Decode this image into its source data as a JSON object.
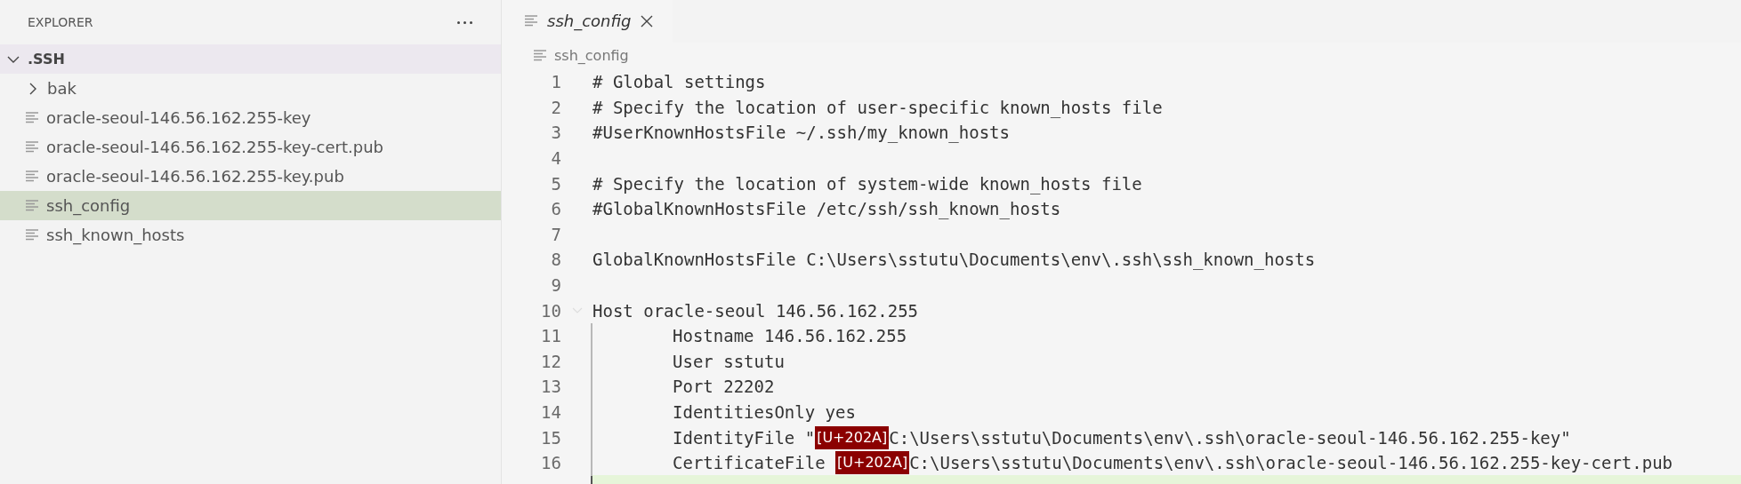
{
  "sidebar": {
    "title": "EXPLORER",
    "folder": {
      "label": ".SSH",
      "expanded": true,
      "children": [
        {
          "kind": "folder",
          "label": "bak",
          "expanded": false,
          "selected": false
        },
        {
          "kind": "file",
          "label": "oracle-seoul-146.56.162.255-key",
          "selected": false
        },
        {
          "kind": "file",
          "label": "oracle-seoul-146.56.162.255-key-cert.pub",
          "selected": false
        },
        {
          "kind": "file",
          "label": "oracle-seoul-146.56.162.255-key.pub",
          "selected": false
        },
        {
          "kind": "file",
          "label": "ssh_config",
          "selected": true
        },
        {
          "kind": "file",
          "label": "ssh_known_hosts",
          "selected": false
        }
      ]
    }
  },
  "tabs": [
    {
      "label": "ssh_config",
      "selected": true,
      "preview": true
    }
  ],
  "breadcrumb": {
    "label": "ssh_config"
  },
  "editor": {
    "lines": [
      {
        "number": "1",
        "indented": false,
        "parts": [
          {
            "kind": "text",
            "text": "# Global settings"
          }
        ]
      },
      {
        "number": "2",
        "indented": false,
        "parts": [
          {
            "kind": "text",
            "text": "# Specify the location of user-specific known_hosts file"
          }
        ]
      },
      {
        "number": "3",
        "indented": false,
        "parts": [
          {
            "kind": "text",
            "text": "#UserKnownHostsFile ~/.ssh/my_known_hosts"
          }
        ]
      },
      {
        "number": "4",
        "indented": false
      },
      {
        "number": "5",
        "indented": false,
        "parts": [
          {
            "kind": "text",
            "text": "# Specify the location of system-wide known_hosts file"
          }
        ]
      },
      {
        "number": "6",
        "indented": false,
        "parts": [
          {
            "kind": "text",
            "text": "#GlobalKnownHostsFile /etc/ssh/ssh_known_hosts"
          }
        ]
      },
      {
        "number": "7",
        "indented": false
      },
      {
        "number": "8",
        "indented": false,
        "parts": [
          {
            "kind": "text",
            "text": "GlobalKnownHostsFile C:\\Users\\sstutu\\Documents\\env\\.ssh\\ssh_known_hosts"
          }
        ]
      },
      {
        "number": "9",
        "indented": false
      },
      {
        "number": "10",
        "indented": false,
        "foldable": true,
        "parts": [
          {
            "kind": "text",
            "text": "Host oracle-seoul 146.56.162.255"
          }
        ]
      },
      {
        "number": "11",
        "indented": true,
        "parts": [
          {
            "kind": "text",
            "text": "Hostname 146.56.162.255"
          }
        ]
      },
      {
        "number": "12",
        "indented": true,
        "parts": [
          {
            "kind": "text",
            "text": "User sstutu"
          }
        ]
      },
      {
        "number": "13",
        "indented": true,
        "parts": [
          {
            "kind": "text",
            "text": "Port 22202"
          }
        ]
      },
      {
        "number": "14",
        "indented": true,
        "parts": [
          {
            "kind": "text",
            "text": "IdentitiesOnly yes"
          }
        ]
      },
      {
        "number": "15",
        "indented": true,
        "parts": [
          {
            "kind": "text",
            "text": "IdentityFile \""
          },
          {
            "kind": "control",
            "text": "[U+202A]"
          },
          {
            "kind": "text",
            "text": "C:\\Users\\sstutu\\Documents\\env\\.ssh\\oracle-seoul-146.56.162.255-key\""
          }
        ]
      },
      {
        "number": "16",
        "indented": true,
        "parts": [
          {
            "kind": "text",
            "text": "CertificateFile "
          },
          {
            "kind": "control",
            "text": "[U+202A]"
          },
          {
            "kind": "text",
            "text": "C:\\Users\\sstutu\\Documents\\env\\.ssh\\oracle-seoul-146.56.162.255-key-cert.pub"
          }
        ]
      }
    ],
    "cursor_line_below": true
  }
}
